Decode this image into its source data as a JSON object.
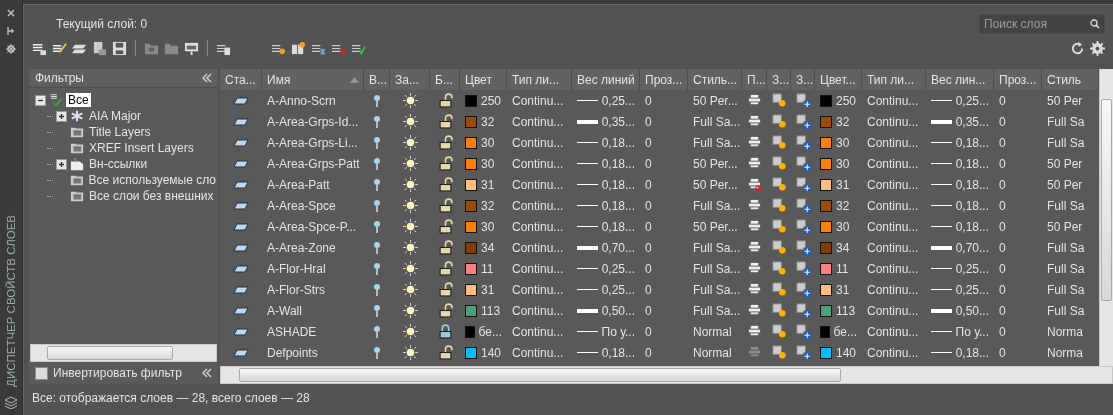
{
  "sidebar_label": "ДИСПЕТЧЕР СВОЙСТВ СЛОЕВ",
  "current_layer": "Текущий слой: 0",
  "search": {
    "placeholder": "Поиск слоя"
  },
  "filters": {
    "title": "Фильтры",
    "tree": [
      {
        "label": "Все",
        "kind": "all",
        "selected": true,
        "expanded": true,
        "children": [
          {
            "label": "AIA Major",
            "kind": "property",
            "selected": false,
            "expanded": false
          },
          {
            "label": "Title Layers",
            "kind": "group",
            "selected": false
          },
          {
            "label": "XREF Insert Layers",
            "kind": "group",
            "selected": false
          },
          {
            "label": "Вн-ссылки",
            "kind": "xref",
            "selected": false,
            "expanded": false
          },
          {
            "label": "Все используемые сло",
            "kind": "group",
            "selected": false
          },
          {
            "label": "Все слои без внешних",
            "kind": "group",
            "selected": false
          }
        ]
      }
    ],
    "invert": {
      "label": "Инвертировать фильтр",
      "checked": false
    }
  },
  "table": {
    "columns": [
      {
        "label": "Ста...",
        "sorted": false
      },
      {
        "label": "Имя",
        "sorted": true
      },
      {
        "label": "В...",
        "sorted": false
      },
      {
        "label": "За...",
        "sorted": false
      },
      {
        "label": "Б...",
        "sorted": false
      },
      {
        "label": "Цвет",
        "sorted": false
      },
      {
        "label": "Тип ли...",
        "sorted": false
      },
      {
        "label": "Вес линий",
        "sorted": false
      },
      {
        "label": "Проз...",
        "sorted": false
      },
      {
        "label": "Стиль...",
        "sorted": false
      },
      {
        "label": "П...",
        "sorted": false
      },
      {
        "label": "З...",
        "sorted": false
      },
      {
        "label": "З...",
        "sorted": false
      },
      {
        "label": "Цвет...",
        "sorted": false
      },
      {
        "label": "Тип ли...",
        "sorted": false
      },
      {
        "label": "Вес лин...",
        "sorted": false
      },
      {
        "label": "Проз...",
        "sorted": false
      },
      {
        "label": "Стиль",
        "sorted": false
      }
    ],
    "rows": [
      {
        "name": "A-Anno-Scrn",
        "on": true,
        "frozen": false,
        "locked": false,
        "color": "#000000",
        "color_name": "250",
        "linetype": "Continu...",
        "lineweight": "0,25...",
        "thick_line": false,
        "transparency": "0",
        "plot_style": "50 Per...",
        "plot": true,
        "plot_disabled": false,
        "vp_color_name": "250",
        "vp_linetype": "Continu...",
        "vp_lineweight": "0,25...",
        "vp_transparency": "0",
        "vp_plot_style": "50 Per"
      },
      {
        "name": "A-Area-Grps-Id...",
        "on": true,
        "frozen": false,
        "locked": false,
        "color": "#9c4c00",
        "color_name": "32",
        "linetype": "Continu...",
        "lineweight": "0,35...",
        "thick_line": true,
        "transparency": "0",
        "plot_style": "Full Sa...",
        "plot": true,
        "plot_disabled": false,
        "vp_color_name": "32",
        "vp_linetype": "Continu...",
        "vp_lineweight": "0,35...",
        "vp_transparency": "0",
        "vp_plot_style": "Full Sa"
      },
      {
        "name": "A-Area-Grps-Li...",
        "on": true,
        "frozen": false,
        "locked": false,
        "color": "#ff7f00",
        "color_name": "30",
        "linetype": "Continu...",
        "lineweight": "0,18...",
        "thick_line": false,
        "transparency": "0",
        "plot_style": "Full Sa...",
        "plot": true,
        "plot_disabled": false,
        "vp_color_name": "30",
        "vp_linetype": "Continu...",
        "vp_lineweight": "0,18...",
        "vp_transparency": "0",
        "vp_plot_style": "Full Sa"
      },
      {
        "name": "A-Area-Grps-Patt",
        "on": true,
        "frozen": false,
        "locked": false,
        "color": "#ff7f00",
        "color_name": "30",
        "linetype": "Continu...",
        "lineweight": "0,18...",
        "thick_line": false,
        "transparency": "0",
        "plot_style": "50 Per...",
        "plot": true,
        "plot_disabled": false,
        "vp_color_name": "30",
        "vp_linetype": "Continu...",
        "vp_lineweight": "0,18...",
        "vp_transparency": "0",
        "vp_plot_style": "50 Per"
      },
      {
        "name": "A-Area-Patt",
        "on": true,
        "frozen": false,
        "locked": false,
        "color": "#ffbf7f",
        "color_name": "31",
        "linetype": "Continu...",
        "lineweight": "0,18...",
        "thick_line": false,
        "transparency": "0",
        "plot_style": "50 Per...",
        "plot": false,
        "plot_disabled": false,
        "vp_color_name": "31",
        "vp_linetype": "Continu...",
        "vp_lineweight": "0,18...",
        "vp_transparency": "0",
        "vp_plot_style": "50 Per"
      },
      {
        "name": "A-Area-Spce",
        "on": true,
        "frozen": false,
        "locked": false,
        "color": "#9c4c00",
        "color_name": "32",
        "linetype": "Continu...",
        "lineweight": "0,18...",
        "thick_line": false,
        "transparency": "0",
        "plot_style": "Full Sa...",
        "plot": true,
        "plot_disabled": false,
        "vp_color_name": "32",
        "vp_linetype": "Continu...",
        "vp_lineweight": "0,18...",
        "vp_transparency": "0",
        "vp_plot_style": "Full Sa"
      },
      {
        "name": "A-Area-Spce-P...",
        "on": true,
        "frozen": false,
        "locked": false,
        "color": "#ff7f00",
        "color_name": "30",
        "linetype": "Continu...",
        "lineweight": "0,18...",
        "thick_line": false,
        "transparency": "0",
        "plot_style": "50 Per...",
        "plot": true,
        "plot_disabled": false,
        "vp_color_name": "30",
        "vp_linetype": "Continu...",
        "vp_lineweight": "0,18...",
        "vp_transparency": "0",
        "vp_plot_style": "50 Per"
      },
      {
        "name": "A-Area-Zone",
        "on": true,
        "frozen": false,
        "locked": false,
        "color": "#7f3f00",
        "color_name": "34",
        "linetype": "Continu...",
        "lineweight": "0,70...",
        "thick_line": true,
        "transparency": "0",
        "plot_style": "Full Sa...",
        "plot": true,
        "plot_disabled": false,
        "vp_color_name": "34",
        "vp_linetype": "Continu...",
        "vp_lineweight": "0,70...",
        "vp_transparency": "0",
        "vp_plot_style": "Full Sa"
      },
      {
        "name": "A-Flor-Hral",
        "on": true,
        "frozen": false,
        "locked": false,
        "color": "#ff7f7f",
        "color_name": "11",
        "linetype": "Continu...",
        "lineweight": "0,25...",
        "thick_line": false,
        "transparency": "0",
        "plot_style": "Full Sa...",
        "plot": true,
        "plot_disabled": false,
        "vp_color_name": "11",
        "vp_linetype": "Continu...",
        "vp_lineweight": "0,25...",
        "vp_transparency": "0",
        "vp_plot_style": "Full Sa"
      },
      {
        "name": "A-Flor-Strs",
        "on": true,
        "frozen": false,
        "locked": false,
        "color": "#ffbf7f",
        "color_name": "31",
        "linetype": "Continu...",
        "lineweight": "0,25...",
        "thick_line": false,
        "transparency": "0",
        "plot_style": "Full Sa...",
        "plot": true,
        "plot_disabled": false,
        "vp_color_name": "31",
        "vp_linetype": "Continu...",
        "vp_lineweight": "0,25...",
        "vp_transparency": "0",
        "vp_plot_style": "Full Sa"
      },
      {
        "name": "A-Wall",
        "on": true,
        "frozen": false,
        "locked": false,
        "color": "#4ca176",
        "color_name": "113",
        "linetype": "Continu...",
        "lineweight": "0,50...",
        "thick_line": true,
        "transparency": "0",
        "plot_style": "Full Sa...",
        "plot": true,
        "plot_disabled": false,
        "vp_color_name": "113",
        "vp_linetype": "Continu...",
        "vp_lineweight": "0,50...",
        "vp_transparency": "0",
        "vp_plot_style": "Full Sa"
      },
      {
        "name": "ASHADE",
        "on": true,
        "frozen": false,
        "locked": true,
        "color": "#000000",
        "color_name": "бе...",
        "linetype": "Continu...",
        "lineweight": "По у...",
        "thick_line": false,
        "transparency": "0",
        "plot_style": "Normal",
        "plot": true,
        "plot_disabled": false,
        "vp_color_name": "бе...",
        "vp_linetype": "Continu...",
        "vp_lineweight": "По у...",
        "vp_transparency": "0",
        "vp_plot_style": "Norma"
      },
      {
        "name": "Defpoints",
        "on": true,
        "frozen": false,
        "locked": false,
        "color": "#00bfff",
        "color_name": "140",
        "linetype": "Continu...",
        "lineweight": "0,18...",
        "thick_line": false,
        "transparency": "0",
        "plot_style": "Normal",
        "plot": true,
        "plot_disabled": true,
        "vp_color_name": "140",
        "vp_linetype": "Continu...",
        "vp_lineweight": "0,18...",
        "vp_transparency": "0",
        "vp_plot_style": "Norma"
      }
    ]
  },
  "status_bar": "Все: отображается слоев — 28, всего слоев — 28"
}
